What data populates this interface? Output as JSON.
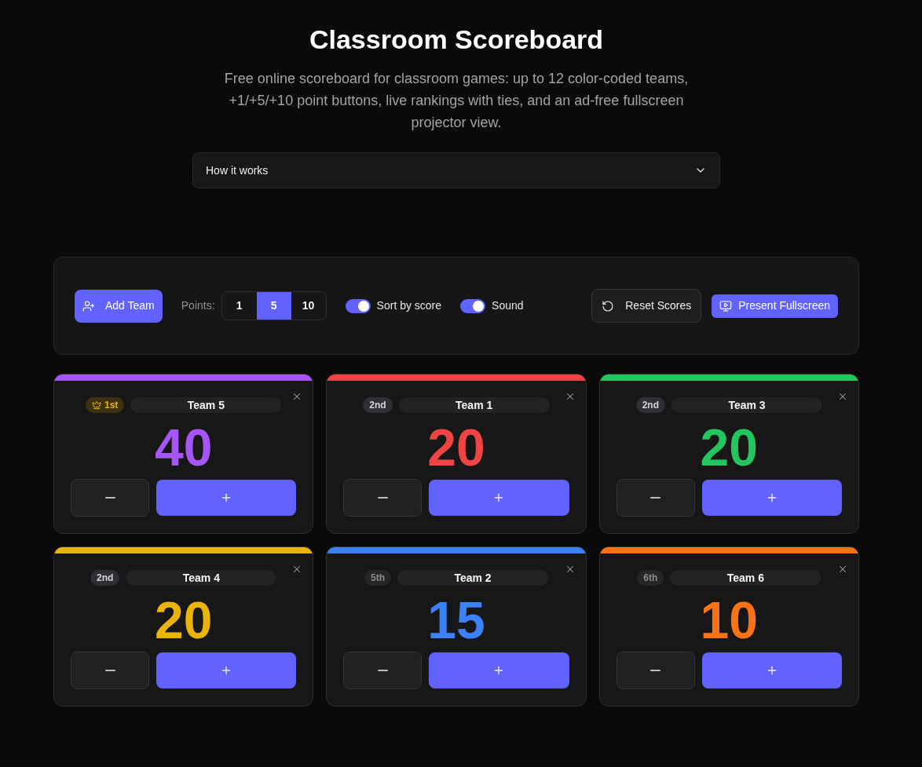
{
  "header": {
    "title": "Classroom Scoreboard",
    "description": "Free online scoreboard for classroom games: up to 12 color-coded teams, +1/+5/+10 point buttons, live rankings with ties, and an ad-free fullscreen projector view."
  },
  "accordion": {
    "label": "How it works",
    "expanded": false
  },
  "toolbar": {
    "add_button": "Add Team",
    "points": {
      "label": "Points:",
      "options": [
        {
          "label": "1",
          "selected": false
        },
        {
          "label": "5",
          "selected": true
        },
        {
          "label": "10",
          "selected": false
        }
      ]
    },
    "toggles": [
      {
        "label": "Sort by score",
        "on": true
      },
      {
        "label": "Sound",
        "on": true
      }
    ],
    "reset_button": "Reset Scores",
    "present_button": "Present Fullscreen"
  },
  "teams": [
    {
      "name": "Team 5",
      "rank": "1st",
      "kind": "first",
      "score": "40",
      "color": "#a855f7"
    },
    {
      "name": "Team 1",
      "rank": "2nd",
      "kind": "podium",
      "score": "20",
      "color": "#ef4444"
    },
    {
      "name": "Team 3",
      "rank": "2nd",
      "kind": "podium",
      "score": "20",
      "color": "#22c55e"
    },
    {
      "name": "Team 4",
      "rank": "2nd",
      "kind": "podium",
      "score": "20",
      "color": "#eab308"
    },
    {
      "name": "Team 2",
      "rank": "5th",
      "kind": "other",
      "score": "15",
      "color": "#3b82f6"
    },
    {
      "name": "Team 6",
      "rank": "6th",
      "kind": "other",
      "score": "10",
      "color": "#f97316"
    }
  ]
}
